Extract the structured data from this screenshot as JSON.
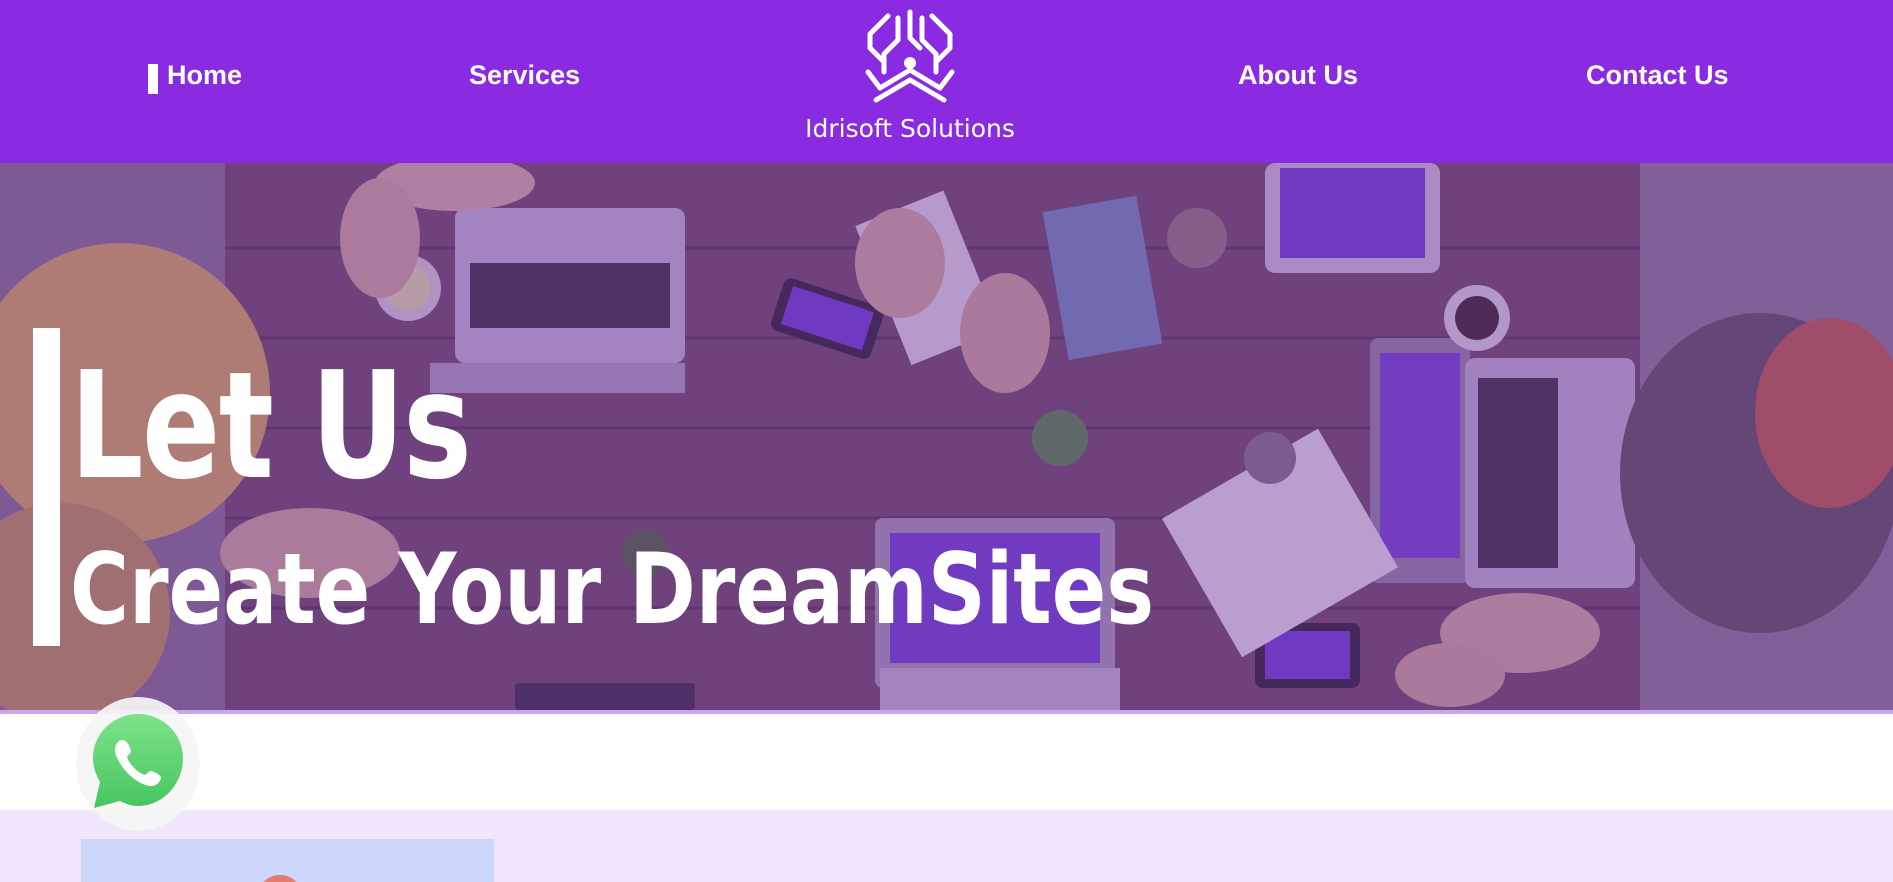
{
  "nav": {
    "left_links": [
      "Home",
      "Services"
    ],
    "right_links": [
      "About Us",
      "Contact Us"
    ],
    "active": "Home",
    "background_color": "#8a2be2"
  },
  "logo": {
    "text": "Idrisoft Solutions",
    "icon": "circuit-logo-icon"
  },
  "hero": {
    "title": "Let Us",
    "subtitle": "Create Your DreamSites",
    "background": "team-working-at-wooden-table-photo",
    "overlay_color": "#7837aa"
  },
  "floating": {
    "icon": "whatsapp-icon"
  },
  "colors": {
    "lavender_section": "#f1e6fb",
    "card": "#ccd7fb"
  }
}
